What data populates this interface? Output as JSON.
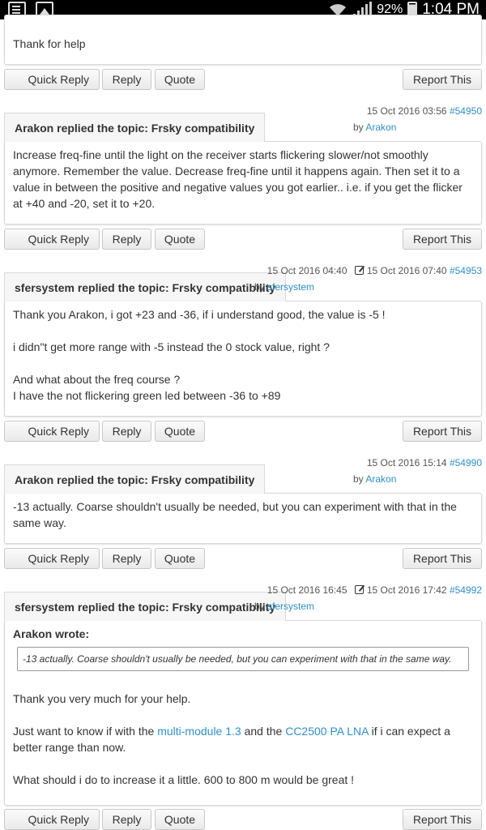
{
  "status_bar": {
    "battery": "92%",
    "time": "1:04 PM",
    "icons": [
      "notes-icon",
      "image-icon",
      "wifi-icon",
      "signal-icon",
      "battery-icon"
    ]
  },
  "actions": {
    "quick_reply": "Quick Reply",
    "reply": "Reply",
    "quote": "Quote",
    "report": "Report This"
  },
  "colors": {
    "link": "#2f8fc9",
    "border": "#d9d9d9"
  },
  "posts": [
    {
      "message": [
        "Thank for help"
      ]
    },
    {
      "header": "Arakon replied the topic: Frsky compatibility",
      "date": "15 Oct 2016 03:56",
      "post_id": "#54950",
      "by": "by",
      "author": "Arakon",
      "message": [
        "Increase freq-fine until the light on the receiver starts flickering slower/not smoothly anymore. Remember the value. Decrease freq-fine until it happens again. Then set it to a value in between the positive and negative values you got earlier.. i.e. if you get the flicker at +40 and -20, set it to +20."
      ]
    },
    {
      "header": "sfersystem replied the topic: Frsky compatibility",
      "date": "15 Oct 2016 04:40",
      "edited_date": "15 Oct 2016 07:40",
      "post_id": "#54953",
      "by": "by",
      "author": "sfersystem",
      "message": [
        "Thank you Arakon, i got +23 and -36, if i understand good, the value is -5 !",
        "i didn\"t get more range with -5 instead the 0 stock value, right ?",
        "And what about the freq course ?",
        "I have the not flickering green led between -36 to +89"
      ]
    },
    {
      "header": "Arakon replied the topic: Frsky compatibility",
      "date": "15 Oct 2016 15:14",
      "post_id": "#54990",
      "by": "by",
      "author": "Arakon",
      "message": [
        "-13 actually. Coarse shouldn't usually be needed, but you can experiment with that in the same way."
      ]
    },
    {
      "header": "sfersystem replied the topic: Frsky compatibility",
      "date": "15 Oct 2016 16:45",
      "edited_date": "15 Oct 2016 17:42",
      "post_id": "#54992",
      "by": "by",
      "author": "sfersystem",
      "quote_author": "Arakon wrote:",
      "quote_text": "-13 actually. Coarse shouldn't usually be needed, but you can experiment with that in the same way.",
      "line1": "Thank you very much for your help.",
      "line2_a": "Just want to know if with the ",
      "link1": "multi-module 1.3",
      "line2_b": " and the ",
      "link2": "CC2500 PA LNA",
      "line2_c": " if i can expect a better range than now.",
      "line3": "What should i do to increase it a little. 600 to 800 m would be great !"
    }
  ]
}
